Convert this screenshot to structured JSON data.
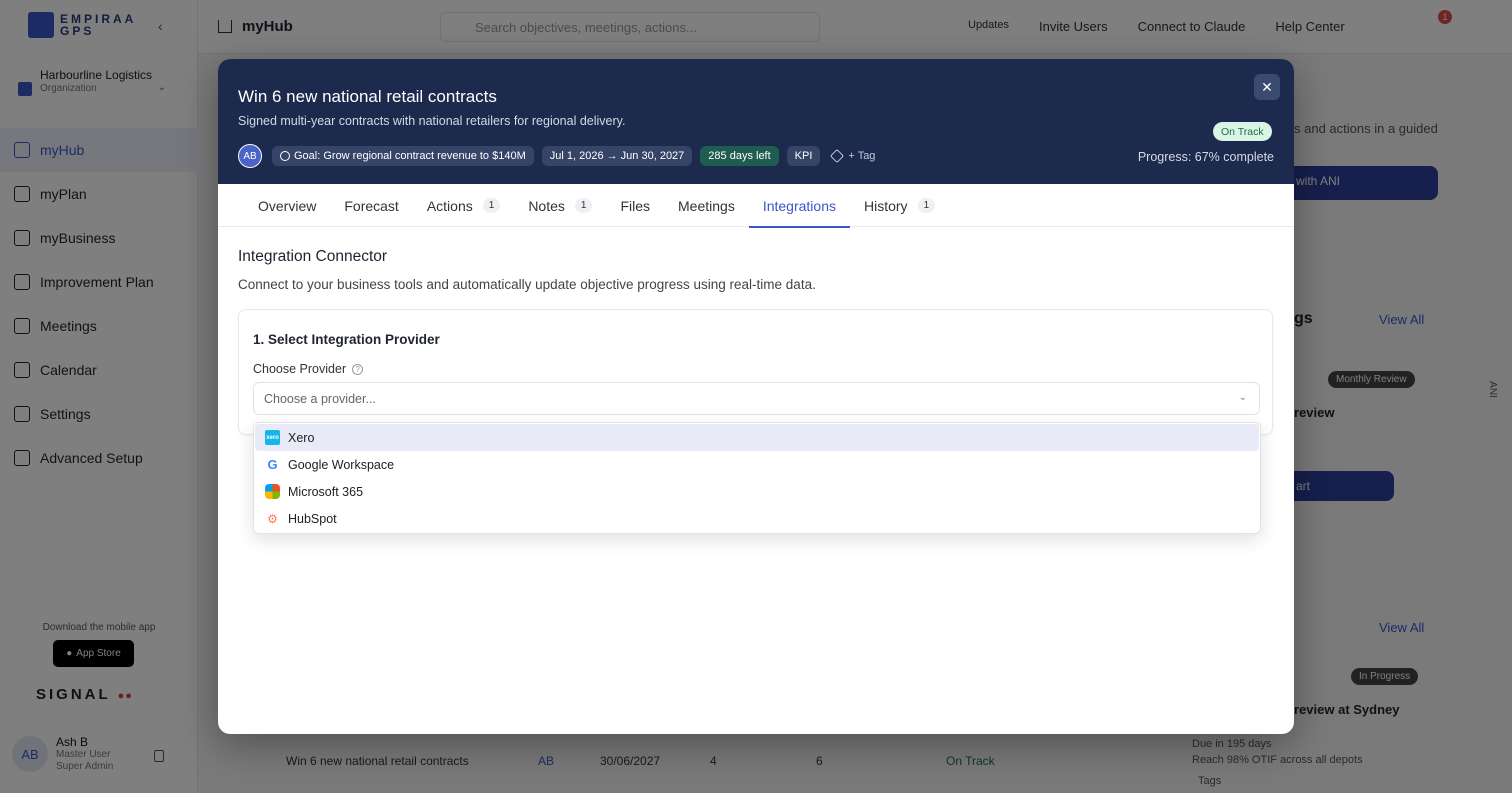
{
  "app": {
    "brand_line1": "EMPIRAA",
    "brand_line2": "GPS",
    "org_name": "Harbourline Logistics",
    "org_type": "Organization",
    "nav": [
      {
        "label": "myHub",
        "active": true
      },
      {
        "label": "myPlan"
      },
      {
        "label": "myBusiness"
      },
      {
        "label": "Improvement Plan"
      },
      {
        "label": "Meetings"
      },
      {
        "label": "Calendar"
      },
      {
        "label": "Settings"
      },
      {
        "label": "Advanced Setup"
      }
    ],
    "mobile_text": "Download the mobile app",
    "appstore_label": "App Store",
    "signal_label": "SIGNAL",
    "user": {
      "initials": "AB",
      "name": "Ash B",
      "role": "Master User",
      "subrole": "Super Admin"
    }
  },
  "topbar": {
    "page_title": "myHub",
    "search_placeholder": "Search objectives, meetings, actions...",
    "updates": "Updates",
    "invite": "Invite Users",
    "connect": "Connect to Claude",
    "help": "Help Center",
    "notif_count": "1"
  },
  "background": {
    "card_text": "s and actions in a guided",
    "btn1": "with ANI",
    "meetings_heading": "gs",
    "view_all_1": "View All",
    "monthly_badge": "Monthly Review",
    "review_text": "review",
    "btn2": "art",
    "view_all_2": "View All",
    "in_progress_badge": "In Progress",
    "sydney_text": "review at Sydney",
    "due_text": "Due in 195 days",
    "reach_text": "Reach 98% OTIF across all depots",
    "tags_text": "Tags",
    "ani_label": "ANI",
    "row": {
      "name": "Win 6 new national retail contracts",
      "owner": "AB",
      "date": "30/06/2027",
      "a": "4",
      "b": "6",
      "status": "On Track"
    }
  },
  "modal": {
    "title": "Win 6 new national retail contracts",
    "description": "Signed multi-year contracts with national retailers for regional delivery.",
    "avatar": "AB",
    "goal_chip": "Goal: Grow regional contract revenue to $140M",
    "date_chip": "Jul 1, 2026 → Jun 30, 2027",
    "days_chip": "285 days left",
    "kpi_chip": "KPI",
    "tag_chip": "+ Tag",
    "status": "On Track",
    "progress": "Progress: 67% complete",
    "progress_value": 67,
    "tabs": [
      {
        "label": "Overview"
      },
      {
        "label": "Forecast"
      },
      {
        "label": "Actions",
        "count": "1"
      },
      {
        "label": "Notes",
        "count": "1"
      },
      {
        "label": "Files"
      },
      {
        "label": "Meetings"
      },
      {
        "label": "Integrations",
        "active": true
      },
      {
        "label": "History",
        "count": "1"
      }
    ],
    "section_title": "Integration Connector",
    "section_desc": "Connect to your business tools and automatically update objective progress using real-time data.",
    "step_title": "1. Select Integration Provider",
    "field_label": "Choose Provider",
    "select_placeholder": "Choose a provider...",
    "providers": [
      {
        "label": "Xero",
        "icon": "xero-icon",
        "highlighted": true
      },
      {
        "label": "Google Workspace",
        "icon": "google-icon"
      },
      {
        "label": "Microsoft 365",
        "icon": "microsoft-365-icon"
      },
      {
        "label": "HubSpot",
        "icon": "hubspot-icon"
      }
    ]
  }
}
